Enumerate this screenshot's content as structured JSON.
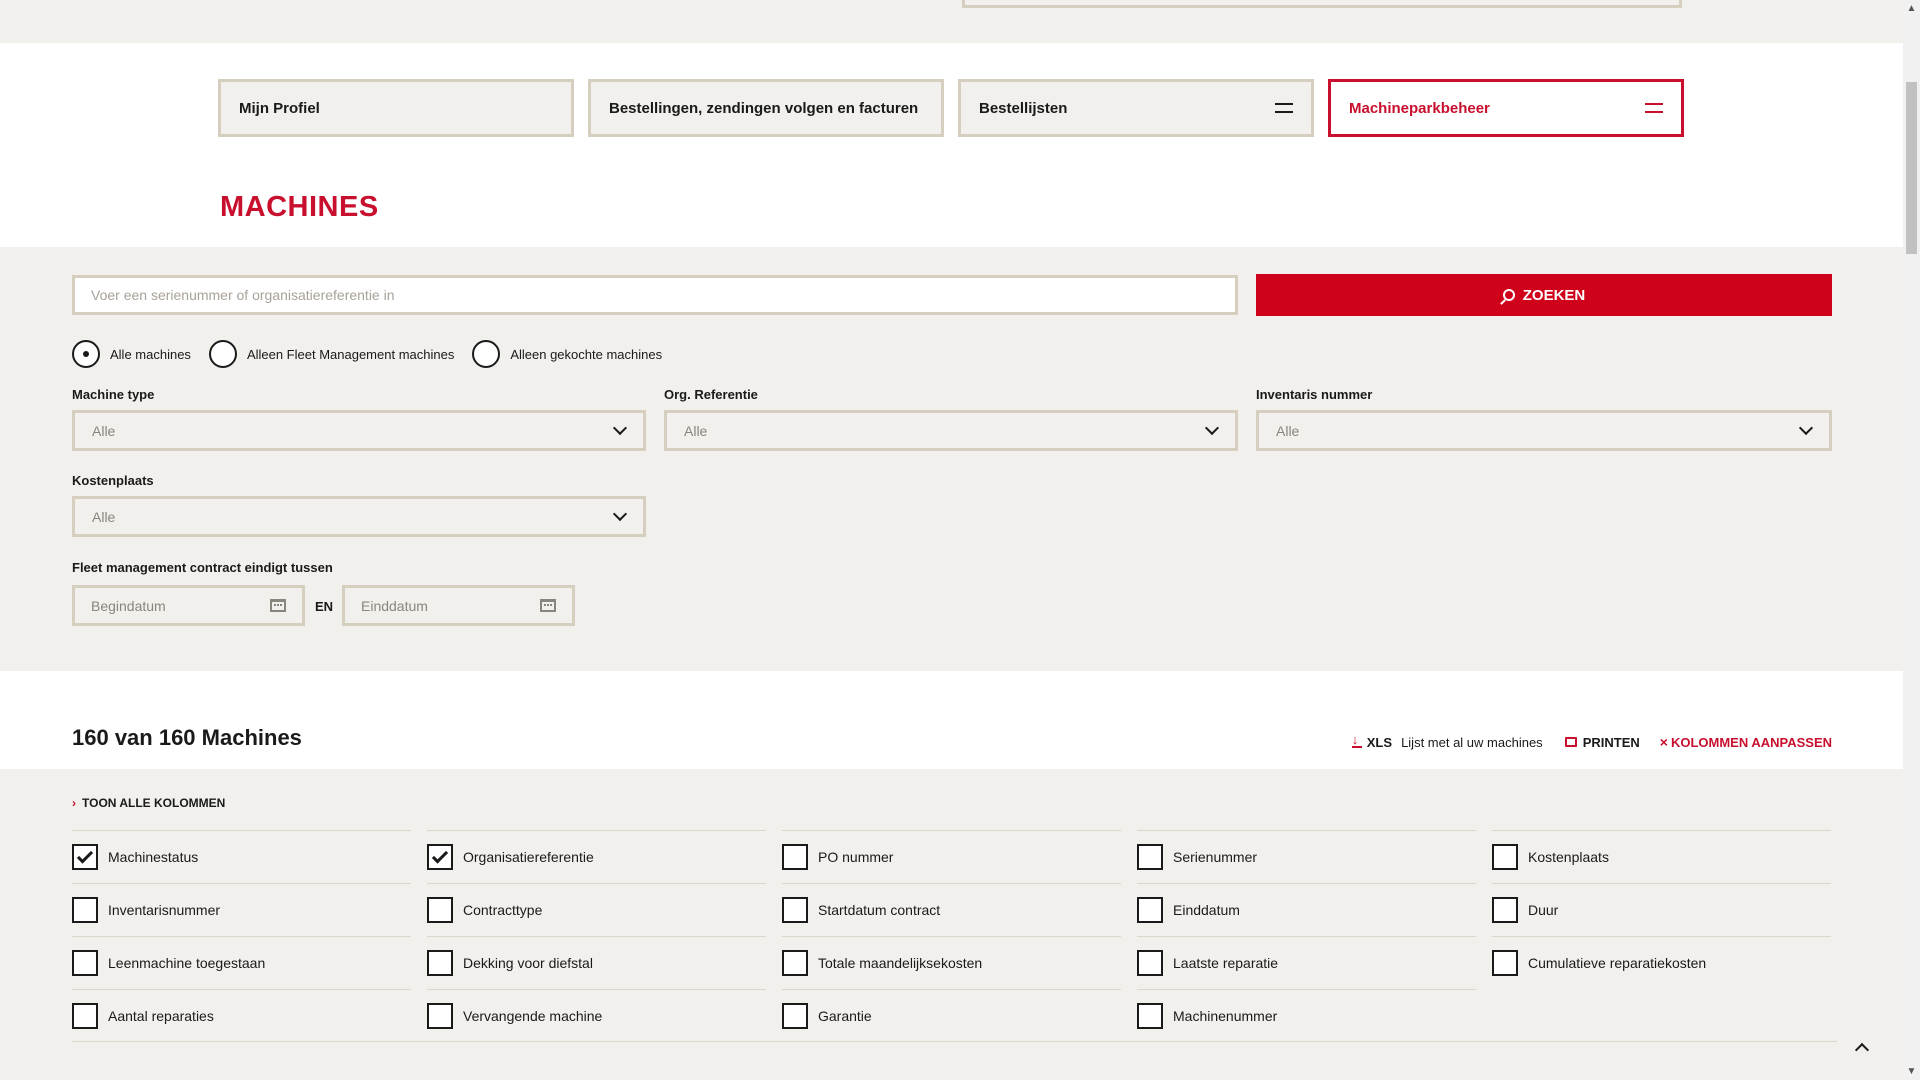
{
  "nav": {
    "tabs": [
      {
        "label": "Mijn Profiel",
        "menu": false,
        "active": false
      },
      {
        "label": "Bestellingen, zendingen volgen en facturen",
        "menu": false,
        "active": false
      },
      {
        "label": "Bestellijsten",
        "menu": true,
        "active": false
      },
      {
        "label": "Machineparkbeheer",
        "menu": true,
        "active": true
      }
    ]
  },
  "page": {
    "title": "MACHINES"
  },
  "search": {
    "placeholder": "Voer een serienummer of organisatiereferentie in",
    "button_label": "ZOEKEN"
  },
  "radio": {
    "options": [
      {
        "label": "Alle machines",
        "selected": true
      },
      {
        "label": "Alleen Fleet Management machines",
        "selected": false
      },
      {
        "label": "Alleen gekochte machines",
        "selected": false
      }
    ]
  },
  "filters": {
    "machine_type": {
      "label": "Machine type",
      "value": "Alle"
    },
    "org_ref": {
      "label": "Org. Referentie",
      "value": "Alle"
    },
    "inventory": {
      "label": "Inventaris nummer",
      "value": "Alle"
    },
    "cost_center": {
      "label": "Kostenplaats",
      "value": "Alle"
    },
    "contract": {
      "label": "Fleet management contract eindigt tussen",
      "start_placeholder": "Begindatum",
      "joiner": "EN",
      "end_placeholder": "Einddatum"
    }
  },
  "results": {
    "count_text": "160 van 160 Machines",
    "xls_label": "XLS",
    "xls_desc": "Lijst met al uw machines",
    "print_label": "PRINTEN",
    "columns_label": "KOLOMMEN AANPASSEN"
  },
  "columns": {
    "toggle_label": "TOON ALLE KOLOMMEN",
    "items": [
      {
        "label": "Machinestatus",
        "checked": true
      },
      {
        "label": "Organisatiereferentie",
        "checked": true
      },
      {
        "label": "PO nummer",
        "checked": false
      },
      {
        "label": "Serienummer",
        "checked": false
      },
      {
        "label": "Kostenplaats",
        "checked": false
      },
      {
        "label": "Inventarisnummer",
        "checked": false
      },
      {
        "label": "Contracttype",
        "checked": false
      },
      {
        "label": "Startdatum contract",
        "checked": false
      },
      {
        "label": "Einddatum",
        "checked": false
      },
      {
        "label": "Duur",
        "checked": false
      },
      {
        "label": "Leenmachine toegestaan",
        "checked": false
      },
      {
        "label": "Dekking voor diefstal",
        "checked": false
      },
      {
        "label": "Totale maandelijksekosten",
        "checked": false
      },
      {
        "label": "Laatste reparatie",
        "checked": false
      },
      {
        "label": "Cumulatieve reparatiekosten",
        "checked": false
      },
      {
        "label": "Aantal reparaties",
        "checked": false
      },
      {
        "label": "Vervangende machine",
        "checked": false
      },
      {
        "label": "Garantie",
        "checked": false
      },
      {
        "label": "Machinenummer",
        "checked": false
      }
    ]
  },
  "colors": {
    "accent": "#c8102e",
    "button": "#d0021b",
    "panel": "#f2f0ec",
    "border": "#d6cfc0"
  }
}
